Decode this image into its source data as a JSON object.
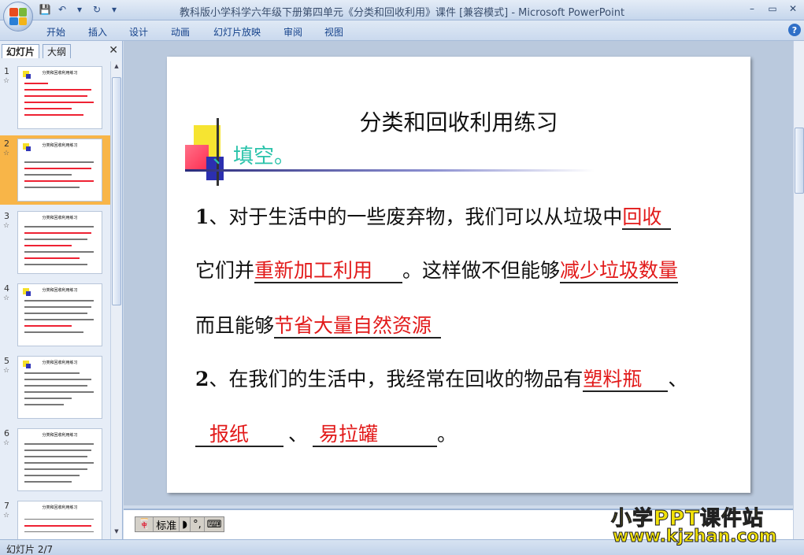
{
  "window": {
    "title": "教科版小学科学六年级下册第四单元《分类和回收利用》课件 [兼容模式] - Microsoft PowerPoint",
    "minimize": "–",
    "restore": "▭",
    "close": "✕"
  },
  "ribbon": {
    "tabs": [
      "开始",
      "插入",
      "设计",
      "动画",
      "幻灯片放映",
      "审阅",
      "视图"
    ],
    "help": "?"
  },
  "left_pane": {
    "tabs": [
      "幻灯片",
      "大纲"
    ],
    "close": "✕",
    "thumbnails": [
      {
        "num": "1",
        "title": "分类和回收利用练习"
      },
      {
        "num": "2",
        "title": "分类和回收利用练习"
      },
      {
        "num": "3",
        "title": "分类和回收利用练习"
      },
      {
        "num": "4",
        "title": "分类和回收利用练习"
      },
      {
        "num": "5",
        "title": "分类和回收利用练习"
      },
      {
        "num": "6",
        "title": "分类和回收利用练习"
      },
      {
        "num": "7",
        "title": "分类和回收利用练习"
      }
    ],
    "selected": 2
  },
  "slide": {
    "title": "分类和回收利用练习",
    "section": "、填空。",
    "q1_num": "1",
    "q1_a": "、对于生活中的一些废弃物，我们可以从垃圾中",
    "q1_ans1": "回收",
    "q1_b": "它们并",
    "q1_ans2": "重新加工利用",
    "q1_c": "。这样做不但能够",
    "q1_ans3": "减少垃圾数量",
    "q1_d": "而且能够",
    "q1_ans4": "节省大量自然资源",
    "q2_num": "2",
    "q2_a": "、在我们的生活中，我经常在回收的物品有",
    "q2_ans1": "塑料瓶",
    "q2_sep": "、",
    "q2_ans2": "报纸",
    "q2_sep2": "、",
    "q2_ans3": "易拉罐",
    "q2_end": "。"
  },
  "ime": {
    "mode": "标准"
  },
  "status": {
    "text": "幻灯片 2/7"
  },
  "watermark": {
    "line1": "小学PPT课件站",
    "line2": "www.kjzhan.com"
  }
}
